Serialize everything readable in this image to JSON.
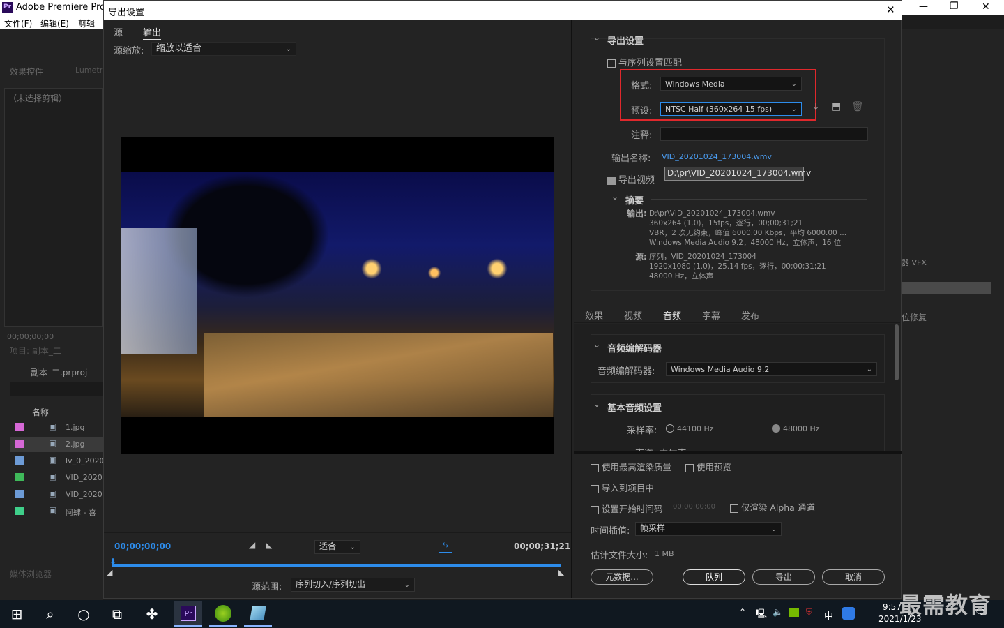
{
  "app": {
    "title": "Adobe Premiere Pro",
    "menu": [
      "文件(F)",
      "编辑(E)",
      "剪辑(C"
    ],
    "window_controls": [
      "—",
      "❐",
      "✕"
    ]
  },
  "left_panel": {
    "effect_controls": "效果控件",
    "lumetri": "Lumetri",
    "no_clip": "（未选择剪辑）",
    "timecode": "00;00;00;00",
    "project": "项目: 副本_二",
    "project_file": "副本_二.prproj",
    "name_col": "名称",
    "items": [
      {
        "name": "1.jpg",
        "color": "#d668d6"
      },
      {
        "name": "2.jpg",
        "color": "#d668d6"
      },
      {
        "name": "lv_0_2020",
        "color": "#6d9bd6"
      },
      {
        "name": "VID_20201",
        "color": "#3fb95a"
      },
      {
        "name": "VID_20201",
        "color": "#6d9bd6"
      },
      {
        "name": "阿肆 - 喜",
        "color": "#3fcf8a"
      }
    ],
    "media_browser": "媒体浏览器"
  },
  "right_panel": {
    "vfx": "器 VFX",
    "repair": "位修复"
  },
  "dialog": {
    "title": "导出设置",
    "close": "✕",
    "tabs": [
      "源",
      "输出"
    ],
    "source_scale_label": "源缩放:",
    "source_scale_value": "缩放以适合",
    "timecode_start": "00;00;00;00",
    "timecode_end": "00;00;31;21",
    "fit_value": "适合",
    "source_range_label": "源范围:",
    "source_range_value": "序列切入/序列切出",
    "export_settings": "导出设置",
    "match_sequence": "与序列设置匹配",
    "format_label": "格式:",
    "format_value": "Windows Media",
    "preset_label": "预设:",
    "preset_value": "NTSC Half (360x264 15 fps)",
    "comment_label": "注释:",
    "output_name_label": "输出名称:",
    "output_name_value": "VID_20201024_173004.wmv",
    "export_video": "导出视频",
    "tooltip": "D:\\pr\\VID_20201024_173004.wmv",
    "summary": "摘要",
    "output_head": "输出:",
    "output_lines": [
      "D:\\pr\\VID_20201024_173004.wmv",
      "360x264 (1.0)，15fps，逐行，00;00;31;21",
      "VBR，2 次无约束，峰值 6000.00 Kbps，平均 6000.00 ...",
      "Windows Media Audio 9.2，48000 Hz，立体声，16 位"
    ],
    "source_head": "源:",
    "source_lines": [
      "序列，VID_20201024_173004",
      "1920x1080 (1.0)，25.14 fps，逐行，00;00;31;21",
      "48000 Hz，立体声"
    ],
    "tabs2": [
      "效果",
      "视频",
      "音频",
      "字幕",
      "发布"
    ],
    "audio_codec_section": "音频编解码器",
    "audio_codec_label": "音频编解码器:",
    "audio_codec_value": "Windows Media Audio 9.2",
    "basic_audio": "基本音频设置",
    "sample_rate_label": "采样率:",
    "sample_rate_1": "44100 Hz",
    "sample_rate_2": "48000 Hz",
    "channels_partial": "声道:  立体声",
    "max_render": "使用最高渲染质量",
    "use_preview": "使用预览",
    "import_project": "导入到项目中",
    "set_start_tc": "设置开始时间码",
    "start_tc_value": "00;00;00;00",
    "render_alpha": "仅渲染 Alpha 通道",
    "time_interp_label": "时间插值:",
    "time_interp_value": "帧采样",
    "est_size_label": "估计文件大小:",
    "est_size_value": "1 MB",
    "buttons": {
      "metadata": "元数据...",
      "queue": "队列",
      "export": "导出",
      "cancel": "取消"
    }
  },
  "taskbar": {
    "time": "9:57",
    "date": "2021/1/23",
    "ime": "中",
    "watermark": "最需教育"
  },
  "colors": {
    "accent": "#2d8ceb",
    "highlight_box": "#e0282c",
    "link": "#4a9cf0"
  }
}
